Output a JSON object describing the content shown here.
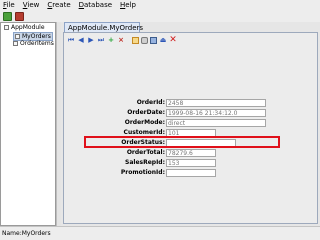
{
  "menubar": {
    "items": [
      {
        "mnemonic": "F",
        "rest": "ile"
      },
      {
        "mnemonic": "V",
        "rest": "iew"
      },
      {
        "mnemonic": "C",
        "rest": "reate"
      },
      {
        "mnemonic": "D",
        "rest": "atabase"
      },
      {
        "mnemonic": "H",
        "rest": "elp"
      }
    ]
  },
  "tree": {
    "root": "AppModule",
    "children": [
      "MyOrders",
      "OrderItems"
    ]
  },
  "tab": {
    "label": "AppModule.MyOrders"
  },
  "form": {
    "fields": [
      {
        "label": "OrderId:",
        "value": "2458"
      },
      {
        "label": "OrderDate:",
        "value": "1999-08-16 21:34:12.0"
      },
      {
        "label": "OrderMode:",
        "value": "direct"
      },
      {
        "label": "CustomerId:",
        "value": "101"
      },
      {
        "label": "OrderStatus:",
        "value": ""
      },
      {
        "label": "OrderTotal:",
        "value": "78279.6"
      },
      {
        "label": "SalesRepId:",
        "value": "153"
      },
      {
        "label": "PromotionId:",
        "value": ""
      }
    ]
  },
  "status": {
    "text": "Name:MyOrders"
  }
}
